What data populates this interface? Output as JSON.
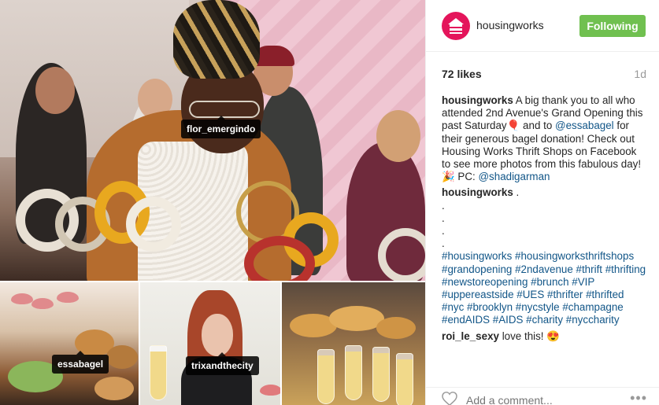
{
  "photo": {
    "tags": {
      "main": "flor_emergindo",
      "left_thumb": "essabagel",
      "middle_thumb": "trixandthecity"
    }
  },
  "header": {
    "username": "housingworks",
    "follow_label": "Following",
    "brand_color": "#e4155b",
    "follow_color": "#70c050"
  },
  "meta": {
    "likes": "72 likes",
    "time": "1d"
  },
  "caption": {
    "user": "housingworks",
    "text1": " A big thank you to all who attended 2nd Avenue's Grand Opening this past Saturday",
    "emoji1": "🎈",
    "text2": " and to ",
    "mention1": "@essabagel",
    "text3": " for their generous bagel donation! Check out Housing Works Thrift Shops on Facebook to see more photos from this fabulous day!",
    "emoji2": "🎉",
    "text4": " PC: ",
    "mention2": "@shadigarman"
  },
  "comment2": {
    "user": "housingworks",
    "text": " .",
    "dots": [
      ".",
      ".",
      ".",
      "."
    ],
    "hashtags": "#housingworks #housingworksthriftshops #grandopening #2ndavenue #thrift #thrifting #newstoreopening #brunch #VIP #uppereastside #UES #thrifter #thrifted #nyc #brooklyn #nycstyle #champagne #endAIDS #AIDS #charity #nyccharity"
  },
  "comment3": {
    "user": "roi_le_sexy",
    "text": " love this! ",
    "emoji": "😍"
  },
  "footer": {
    "placeholder": "Add a comment...",
    "like_icon": "heart-outline-icon",
    "more_icon": "ellipsis-icon",
    "more_glyph": "•••"
  }
}
